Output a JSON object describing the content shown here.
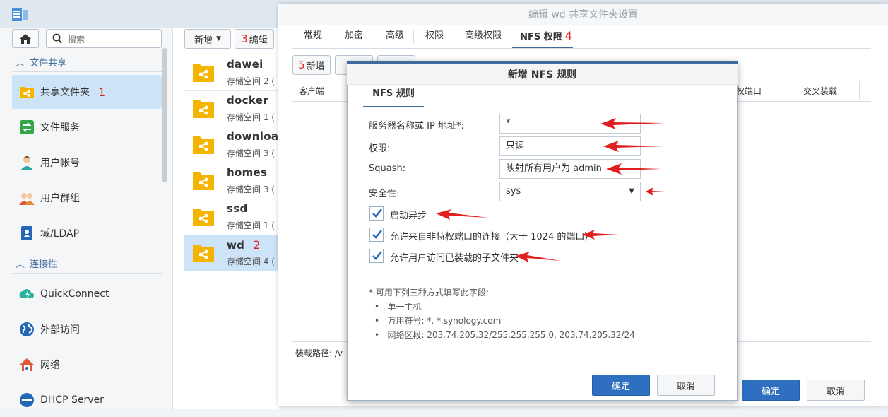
{
  "window": {
    "title": "编辑 wd 共享文件夹设置"
  },
  "sidebar": {
    "search_placeholder": "搜索",
    "sections": [
      {
        "label": "文件共享"
      },
      {
        "label": "连接性"
      }
    ],
    "items": [
      {
        "label": "共享文件夹",
        "badge": "1"
      },
      {
        "label": "文件服务"
      },
      {
        "label": "用户帐号"
      },
      {
        "label": "用户群组"
      },
      {
        "label": "域/LDAP"
      },
      {
        "label": "QuickConnect"
      },
      {
        "label": "外部访问"
      },
      {
        "label": "网络"
      },
      {
        "label": "DHCP Server"
      }
    ]
  },
  "toolbar": {
    "new_label": "新增",
    "edit_label": "编辑",
    "edit_badge": "3"
  },
  "folders": [
    {
      "name": "dawei",
      "sub": "存储空间 2 (",
      "badge": ""
    },
    {
      "name": "docker",
      "sub": "存储空间 1 (",
      "badge": ""
    },
    {
      "name": "download",
      "sub": "存储空间 3 (",
      "badge": ""
    },
    {
      "name": "homes",
      "sub": "存储空间 3 (",
      "badge": ""
    },
    {
      "name": "ssd",
      "sub": "存储空间 1 (",
      "badge": ""
    },
    {
      "name": "wd",
      "sub": "存储空间 4 (",
      "badge": "2"
    }
  ],
  "tabs": [
    {
      "label": "常规"
    },
    {
      "label": "加密"
    },
    {
      "label": "高级"
    },
    {
      "label": "权限"
    },
    {
      "label": "高级权限"
    },
    {
      "label": "NFS 权限",
      "badge": "4"
    }
  ],
  "back_dialog": {
    "new_label": "新增",
    "new_badge": "5",
    "columns": [
      "客户端",
      "权端口",
      "交叉装载"
    ],
    "mount_path_label": "装载路径: /v",
    "ok_label": "确定",
    "cancel_label": "取消"
  },
  "front_dialog": {
    "title": "新增 NFS 规则",
    "tab": "NFS 规则",
    "fields": [
      {
        "label": "服务器名称或 IP 地址*:",
        "value": "*"
      },
      {
        "label": "权限:",
        "value": "只读"
      },
      {
        "label": "Squash:",
        "value": "映射所有用户为 admin"
      },
      {
        "label": "安全性:",
        "value": "sys"
      }
    ],
    "checkboxes": [
      {
        "label": "启动异步",
        "checked": true
      },
      {
        "label": "允许来自非特权端口的连接（大于 1024 的端口）",
        "checked": true
      },
      {
        "label": "允许用户访问已装载的子文件夹",
        "checked": true
      }
    ],
    "note_title": "* 可用下列三种方式填写此字段:",
    "notes": [
      "单一主机",
      "万用符号:   *, *.synology.com",
      "网络区段:   203.74.205.32/255.255.255.0, 203.74.205.32/24"
    ],
    "ok_label": "确定",
    "cancel_label": "取消"
  },
  "colors": {
    "accent": "#3d6a9b",
    "primary": "#2e6fc0",
    "selected": "#cde3f7",
    "folder": "#f5b400",
    "annotation": "#e02020"
  }
}
